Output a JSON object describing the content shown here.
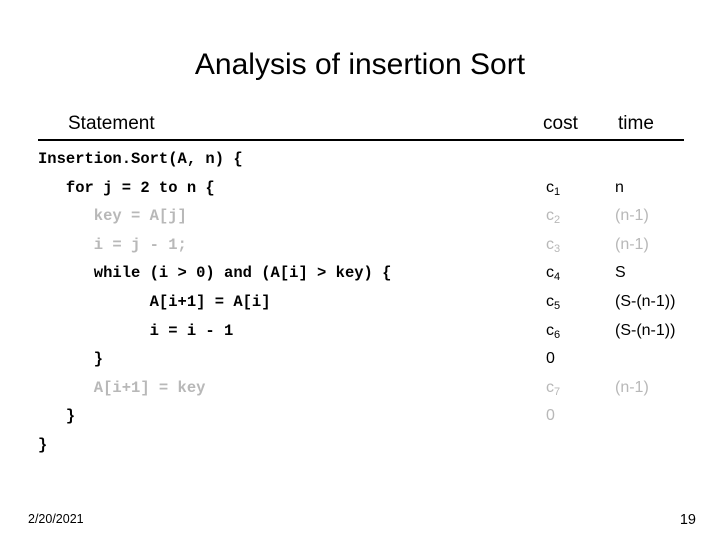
{
  "slide": {
    "title": "Analysis of insertion Sort",
    "header": {
      "statement": "Statement",
      "cost": "cost",
      "time": "time"
    },
    "code_lines": [
      {
        "text": "Insertion.Sort(A, n) {",
        "dim": false
      },
      {
        "text": "   for j = 2 to n {",
        "dim": false
      },
      {
        "text": "      key = A[j]",
        "dim": true
      },
      {
        "text": "      i = j - 1;",
        "dim": true
      },
      {
        "text": "      while (i > 0) and (A[i] > key) {",
        "dim": false
      },
      {
        "text": "            A[i+1] = A[i]",
        "dim": false
      },
      {
        "text": "            i = i - 1",
        "dim": false
      },
      {
        "text": "      }",
        "dim": false
      },
      {
        "text": "      A[i+1] = key",
        "dim": true
      },
      {
        "text": "   }",
        "dim": false
      },
      {
        "text": "}",
        "dim": false
      }
    ],
    "cost_lines": [
      {
        "base": "",
        "sub": "",
        "dim": false
      },
      {
        "base": "c",
        "sub": "1",
        "dim": false
      },
      {
        "base": "c",
        "sub": "2",
        "dim": true
      },
      {
        "base": "c",
        "sub": "3",
        "dim": true
      },
      {
        "base": "c",
        "sub": "4",
        "dim": false
      },
      {
        "base": "c",
        "sub": "5",
        "dim": false
      },
      {
        "base": "c",
        "sub": "6",
        "dim": false
      },
      {
        "base": "0",
        "sub": "",
        "dim": false
      },
      {
        "base": "c",
        "sub": "7",
        "dim": true
      },
      {
        "base": "0",
        "sub": "",
        "dim": true
      },
      {
        "base": "",
        "sub": "",
        "dim": false
      }
    ],
    "time_lines": [
      {
        "text": "",
        "dim": false
      },
      {
        "text": "n",
        "dim": false
      },
      {
        "text": "(n-1)",
        "dim": true
      },
      {
        "text": "(n-1)",
        "dim": true
      },
      {
        "text": "S",
        "dim": false
      },
      {
        "text": "(S-(n-1))",
        "dim": false
      },
      {
        "text": "(S-(n-1))",
        "dim": false
      },
      {
        "text": "",
        "dim": false
      },
      {
        "text": "(n-1)",
        "dim": true
      },
      {
        "text": "",
        "dim": false
      },
      {
        "text": "",
        "dim": false
      }
    ],
    "footer": {
      "date": "2/20/2021",
      "page": "19"
    }
  }
}
